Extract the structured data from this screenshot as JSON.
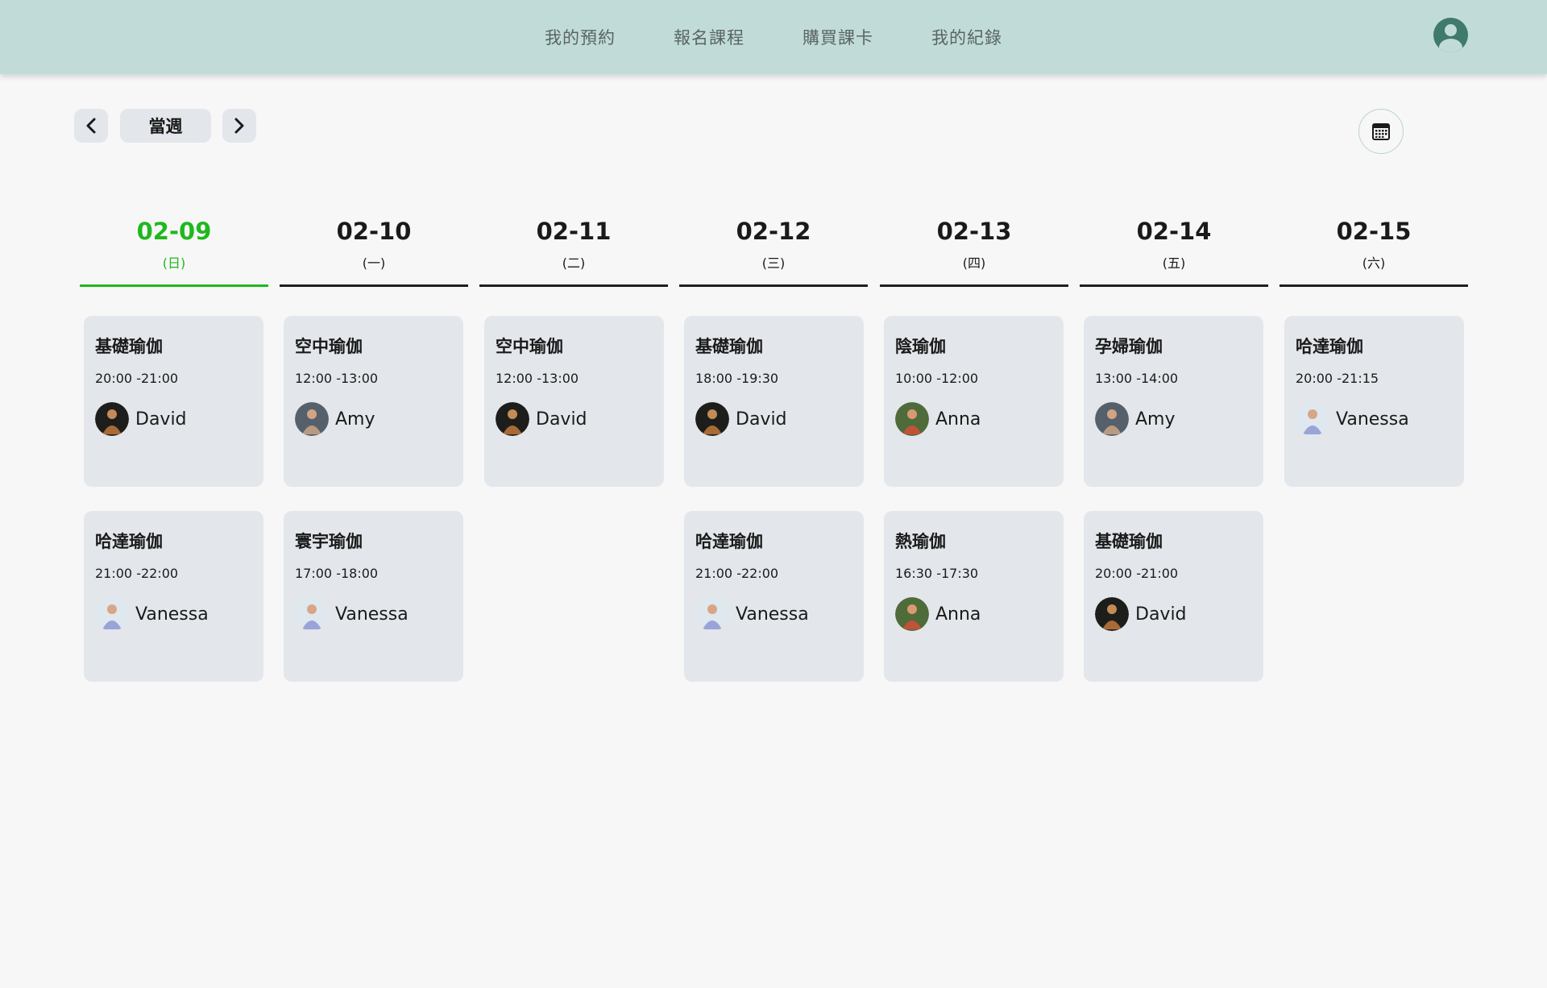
{
  "nav": {
    "items": [
      "我的預約",
      "報名課程",
      "購買課卡",
      "我的紀錄"
    ]
  },
  "controls": {
    "prev_icon": "chevron-left-icon",
    "week_label": "當週",
    "next_icon": "chevron-right-icon",
    "calendar_icon": "calendar-icon",
    "profile_icon": "user-avatar-icon"
  },
  "colors": {
    "header_bg": "#c1dcd8",
    "active": "#1fb81f",
    "card_bg": "#e3e7eb"
  },
  "days": [
    {
      "date": "02-09",
      "weekday": "(日)",
      "active": true
    },
    {
      "date": "02-10",
      "weekday": "(一)",
      "active": false
    },
    {
      "date": "02-11",
      "weekday": "(二)",
      "active": false
    },
    {
      "date": "02-12",
      "weekday": "(三)",
      "active": false
    },
    {
      "date": "02-13",
      "weekday": "(四)",
      "active": false
    },
    {
      "date": "02-14",
      "weekday": "(五)",
      "active": false
    },
    {
      "date": "02-15",
      "weekday": "(六)",
      "active": false
    }
  ],
  "classes": [
    {
      "day": 0,
      "slot": 0,
      "title": "基礎瑜伽",
      "time": "20:00 -21:00",
      "teacher": "David"
    },
    {
      "day": 0,
      "slot": 1,
      "title": "哈達瑜伽",
      "time": "21:00 -22:00",
      "teacher": "Vanessa"
    },
    {
      "day": 1,
      "slot": 0,
      "title": "空中瑜伽",
      "time": "12:00 -13:00",
      "teacher": "Amy"
    },
    {
      "day": 1,
      "slot": 1,
      "title": "寰宇瑜伽",
      "time": "17:00 -18:00",
      "teacher": "Vanessa"
    },
    {
      "day": 2,
      "slot": 0,
      "title": "空中瑜伽",
      "time": "12:00 -13:00",
      "teacher": "David"
    },
    {
      "day": 3,
      "slot": 0,
      "title": "基礎瑜伽",
      "time": "18:00 -19:30",
      "teacher": "David"
    },
    {
      "day": 3,
      "slot": 1,
      "title": "哈達瑜伽",
      "time": "21:00 -22:00",
      "teacher": "Vanessa"
    },
    {
      "day": 4,
      "slot": 0,
      "title": "陰瑜伽",
      "time": "10:00 -12:00",
      "teacher": "Anna"
    },
    {
      "day": 4,
      "slot": 1,
      "title": "熱瑜伽",
      "time": "16:30 -17:30",
      "teacher": "Anna"
    },
    {
      "day": 5,
      "slot": 0,
      "title": "孕婦瑜伽",
      "time": "13:00 -14:00",
      "teacher": "Amy"
    },
    {
      "day": 5,
      "slot": 1,
      "title": "基礎瑜伽",
      "time": "20:00 -21:00",
      "teacher": "David"
    },
    {
      "day": 6,
      "slot": 0,
      "title": "哈達瑜伽",
      "time": "20:00 -21:15",
      "teacher": "Vanessa"
    }
  ]
}
